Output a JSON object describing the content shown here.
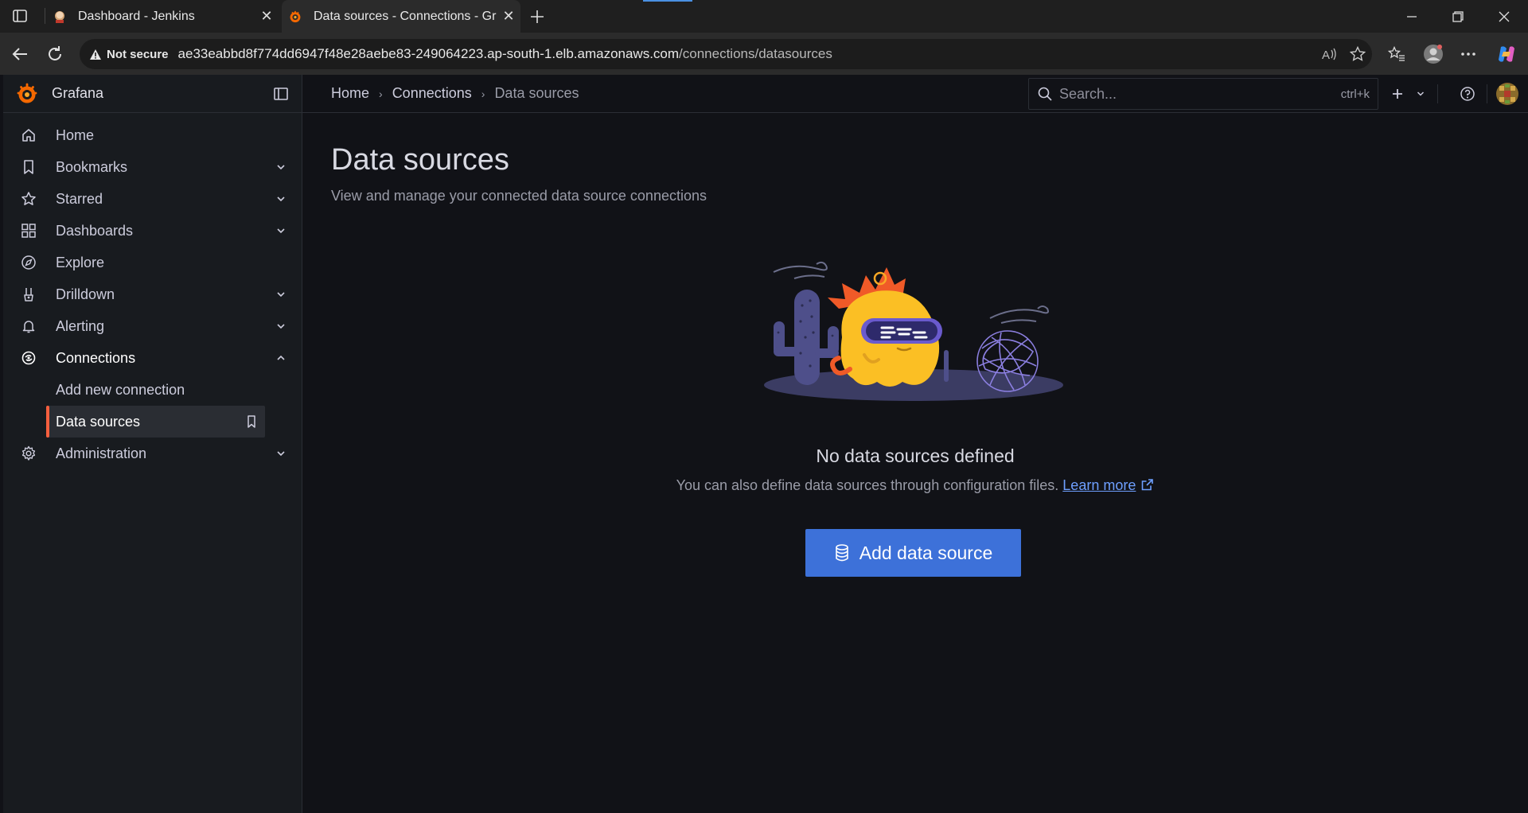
{
  "browser": {
    "tabs": [
      {
        "title": "Dashboard - Jenkins",
        "favicon": "jenkins-icon",
        "active": false
      },
      {
        "title": "Data sources - Connections - Grafana",
        "favicon": "grafana-icon",
        "active": true
      }
    ],
    "address": {
      "security": "Not secure",
      "host": "ae33eabbd8f774dd6947f48e28aebe83-249064223.ap-south-1.elb.amazonaws.com",
      "path": "/connections/datasources"
    }
  },
  "sidebar": {
    "brand": "Grafana",
    "items": [
      {
        "label": "Home",
        "icon": "home-icon",
        "chevron": false
      },
      {
        "label": "Bookmarks",
        "icon": "bookmark-icon",
        "chevron": true
      },
      {
        "label": "Starred",
        "icon": "star-icon",
        "chevron": true
      },
      {
        "label": "Dashboards",
        "icon": "apps-icon",
        "chevron": true
      },
      {
        "label": "Explore",
        "icon": "compass-icon",
        "chevron": true
      },
      {
        "label": "Drilldown",
        "icon": "drilldown-icon",
        "chevron": true
      },
      {
        "label": "Alerting",
        "icon": "bell-icon",
        "chevron": true
      },
      {
        "label": "Connections",
        "icon": "connections-icon",
        "chevron": "up"
      },
      {
        "label": "Add new connection"
      },
      {
        "label": "Data sources"
      },
      {
        "label": "Administration",
        "icon": "cog-icon",
        "chevron": true
      }
    ]
  },
  "topbar": {
    "breadcrumbs": [
      "Home",
      "Connections",
      "Data sources"
    ],
    "search_placeholder": "Search...",
    "search_shortcut": "ctrl+k"
  },
  "page": {
    "title": "Data sources",
    "subtitle": "View and manage your connected data source connections",
    "empty_title": "No data sources defined",
    "empty_desc": "You can also define data sources through configuration files.",
    "learn_more": "Learn more",
    "add_button": "Add data source"
  },
  "colors": {
    "accent": "#3d71d9",
    "active_marker": "#f55f3e",
    "link": "#6e9fff"
  }
}
